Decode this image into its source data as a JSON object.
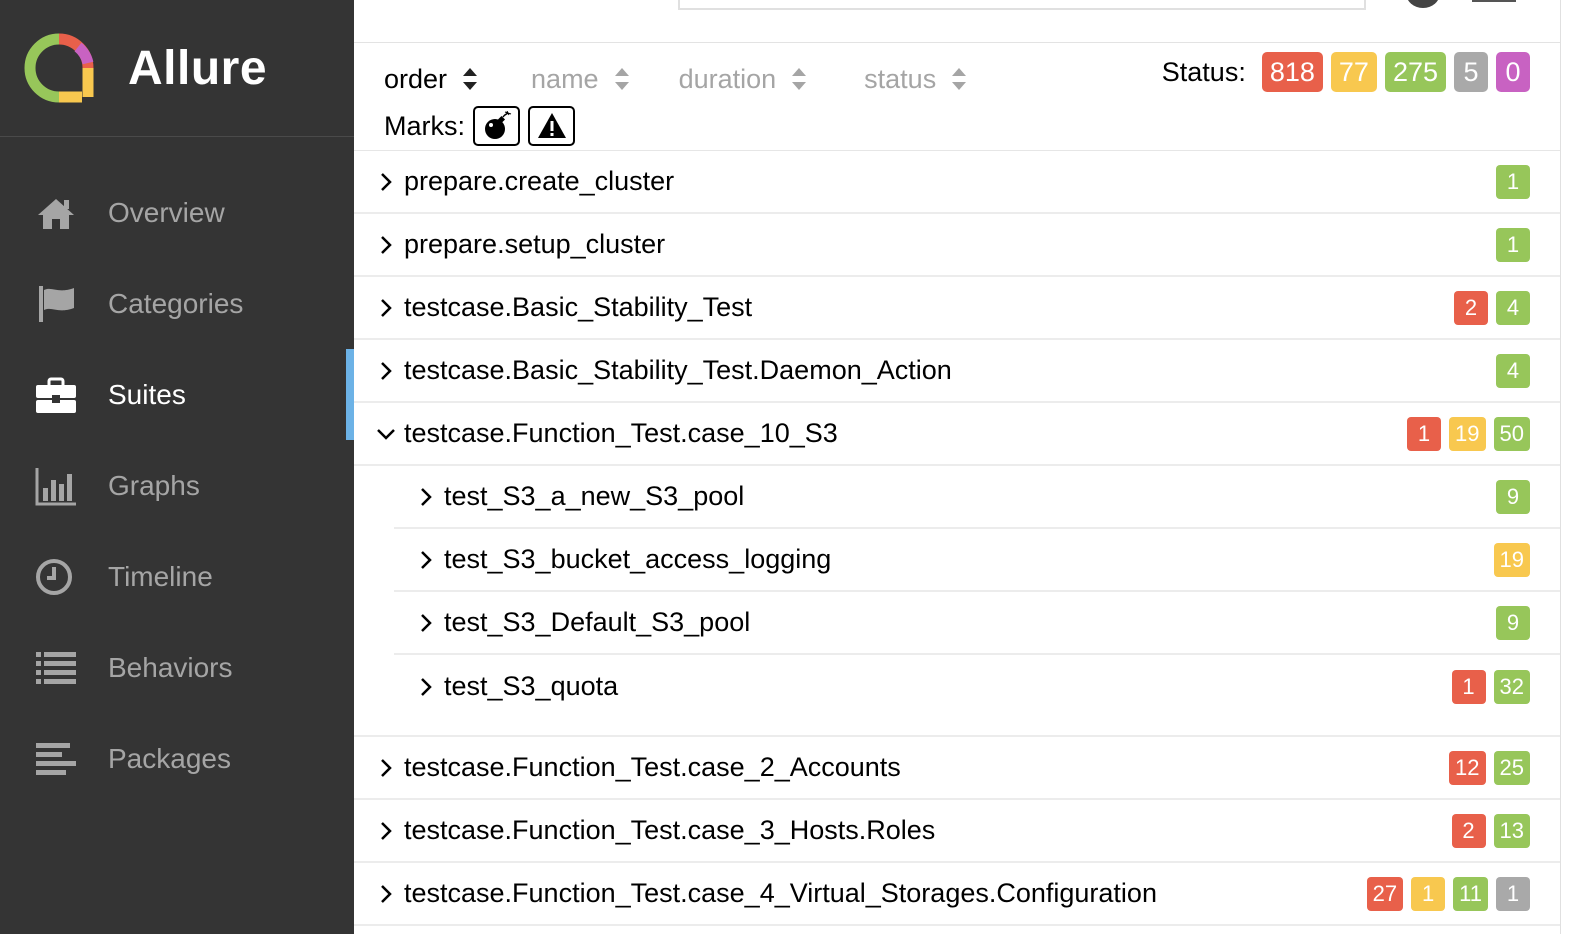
{
  "app": {
    "title": "Allure"
  },
  "sidebar": {
    "items": [
      {
        "label": "Overview",
        "icon": "home-icon"
      },
      {
        "label": "Categories",
        "icon": "flag-icon"
      },
      {
        "label": "Suites",
        "icon": "briefcase-icon",
        "active": true
      },
      {
        "label": "Graphs",
        "icon": "bar-chart-icon"
      },
      {
        "label": "Timeline",
        "icon": "clock-icon"
      },
      {
        "label": "Behaviors",
        "icon": "list-icon"
      },
      {
        "label": "Packages",
        "icon": "align-left-icon"
      }
    ]
  },
  "sort": {
    "order": "order",
    "name": "name",
    "duration": "duration",
    "status": "status"
  },
  "status": {
    "label": "Status:",
    "failed": "818",
    "broken": "77",
    "passed": "275",
    "skipped": "5",
    "unknown": "0"
  },
  "marks": {
    "label": "Marks:",
    "items": [
      "bomb-icon",
      "warning-icon"
    ]
  },
  "colors": {
    "failed": "#e8604a",
    "broken": "#f8c84f",
    "passed": "#97c65a",
    "skipped": "#a9a9a9",
    "unknown": "#c862c2",
    "sidebar_bg": "#343434",
    "active_indicator": "#6cb2e6"
  },
  "tree": [
    {
      "name": "prepare.create_cluster",
      "counts": [
        {
          "status": "passed",
          "value": "1"
        }
      ]
    },
    {
      "name": "prepare.setup_cluster",
      "counts": [
        {
          "status": "passed",
          "value": "1"
        }
      ]
    },
    {
      "name": "testcase.Basic_Stability_Test",
      "counts": [
        {
          "status": "failed",
          "value": "2"
        },
        {
          "status": "passed",
          "value": "4"
        }
      ]
    },
    {
      "name": "testcase.Basic_Stability_Test.Daemon_Action",
      "counts": [
        {
          "status": "passed",
          "value": "4"
        }
      ]
    },
    {
      "name": "testcase.Function_Test.case_10_S3",
      "expanded": true,
      "counts": [
        {
          "status": "failed",
          "value": "1"
        },
        {
          "status": "broken",
          "value": "19"
        },
        {
          "status": "passed",
          "value": "50"
        }
      ],
      "children": [
        {
          "name": "test_S3_a_new_S3_pool",
          "counts": [
            {
              "status": "passed",
              "value": "9"
            }
          ]
        },
        {
          "name": "test_S3_bucket_access_logging",
          "counts": [
            {
              "status": "broken",
              "value": "19"
            }
          ]
        },
        {
          "name": "test_S3_Default_S3_pool",
          "counts": [
            {
              "status": "passed",
              "value": "9"
            }
          ]
        },
        {
          "name": "test_S3_quota",
          "counts": [
            {
              "status": "failed",
              "value": "1"
            },
            {
              "status": "passed",
              "value": "32"
            }
          ]
        }
      ]
    },
    {
      "name": "testcase.Function_Test.case_2_Accounts",
      "counts": [
        {
          "status": "failed",
          "value": "12"
        },
        {
          "status": "passed",
          "value": "25"
        }
      ]
    },
    {
      "name": "testcase.Function_Test.case_3_Hosts.Roles",
      "counts": [
        {
          "status": "failed",
          "value": "2"
        },
        {
          "status": "passed",
          "value": "13"
        }
      ]
    },
    {
      "name": "testcase.Function_Test.case_4_Virtual_Storages.Configuration",
      "counts": [
        {
          "status": "failed",
          "value": "27"
        },
        {
          "status": "broken",
          "value": "1"
        },
        {
          "status": "passed",
          "value": "11"
        },
        {
          "status": "skipped",
          "value": "1"
        }
      ]
    }
  ]
}
